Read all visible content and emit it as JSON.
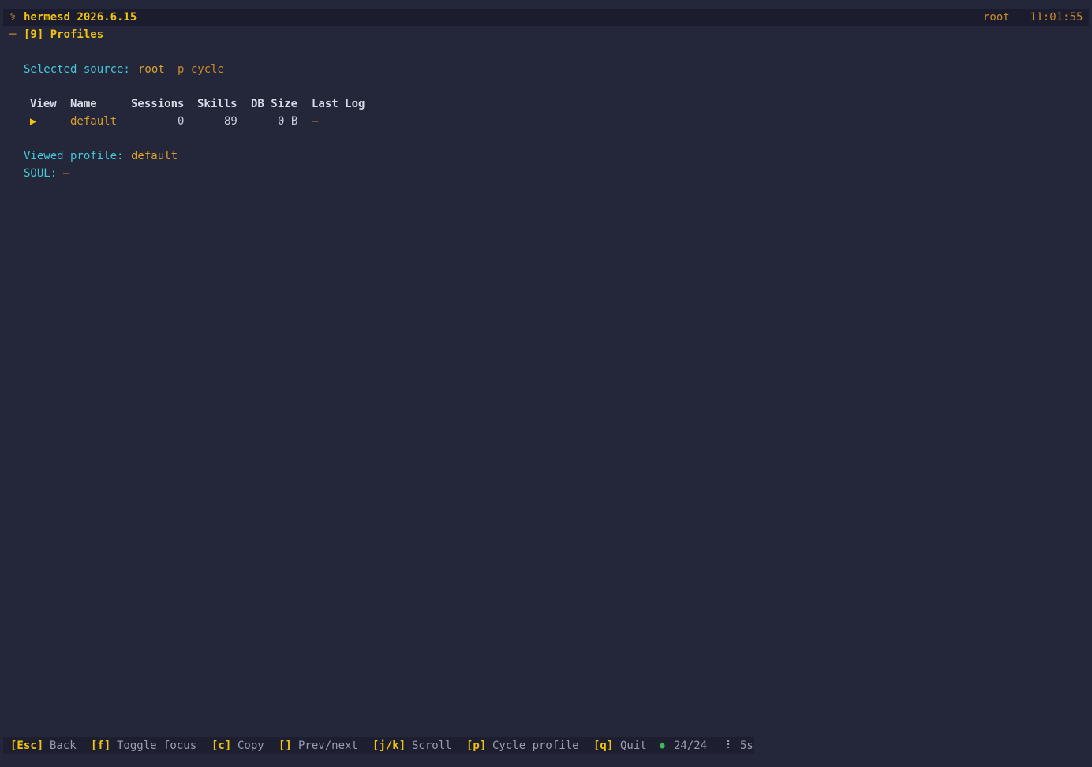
{
  "header": {
    "logo_glyph": "⚕",
    "app_title": "hermesd 2026.6.15",
    "user": "root",
    "clock": "11:01:55"
  },
  "panel": {
    "dash": "─",
    "title": "[9] Profiles"
  },
  "source": {
    "label": "Selected source:",
    "value": "root",
    "hint": "p cycle"
  },
  "table": {
    "columns": [
      "View",
      "Name",
      "Sessions",
      "Skills",
      "DB Size",
      "Last Log"
    ],
    "rows": [
      {
        "view": "▶",
        "name": "default",
        "sessions": "0",
        "skills": "89",
        "db_size": "0 B",
        "last_log": "—"
      }
    ]
  },
  "viewed": {
    "label": "Viewed profile:",
    "value": "default",
    "soul_label": "SOUL:",
    "soul_value": "—"
  },
  "footer": {
    "shortcuts": [
      {
        "key": "[Esc]",
        "desc": "Back"
      },
      {
        "key": "[f]",
        "desc": "Toggle focus"
      },
      {
        "key": "[c]",
        "desc": "Copy"
      },
      {
        "key": "[]",
        "desc": "Prev/next"
      },
      {
        "key": "[j/k]",
        "desc": "Scroll"
      },
      {
        "key": "[p]",
        "desc": "Cycle profile"
      },
      {
        "key": "[q]",
        "desc": "Quit"
      }
    ],
    "status_dot": "●",
    "status_count": "24/24",
    "spinner": "⠇",
    "refresh": "5s"
  },
  "colors": {
    "background": "#242639",
    "accent": "#f1c40f",
    "label": "#45c8d8",
    "rule": "#b8762f",
    "ok": "#3fb950"
  }
}
